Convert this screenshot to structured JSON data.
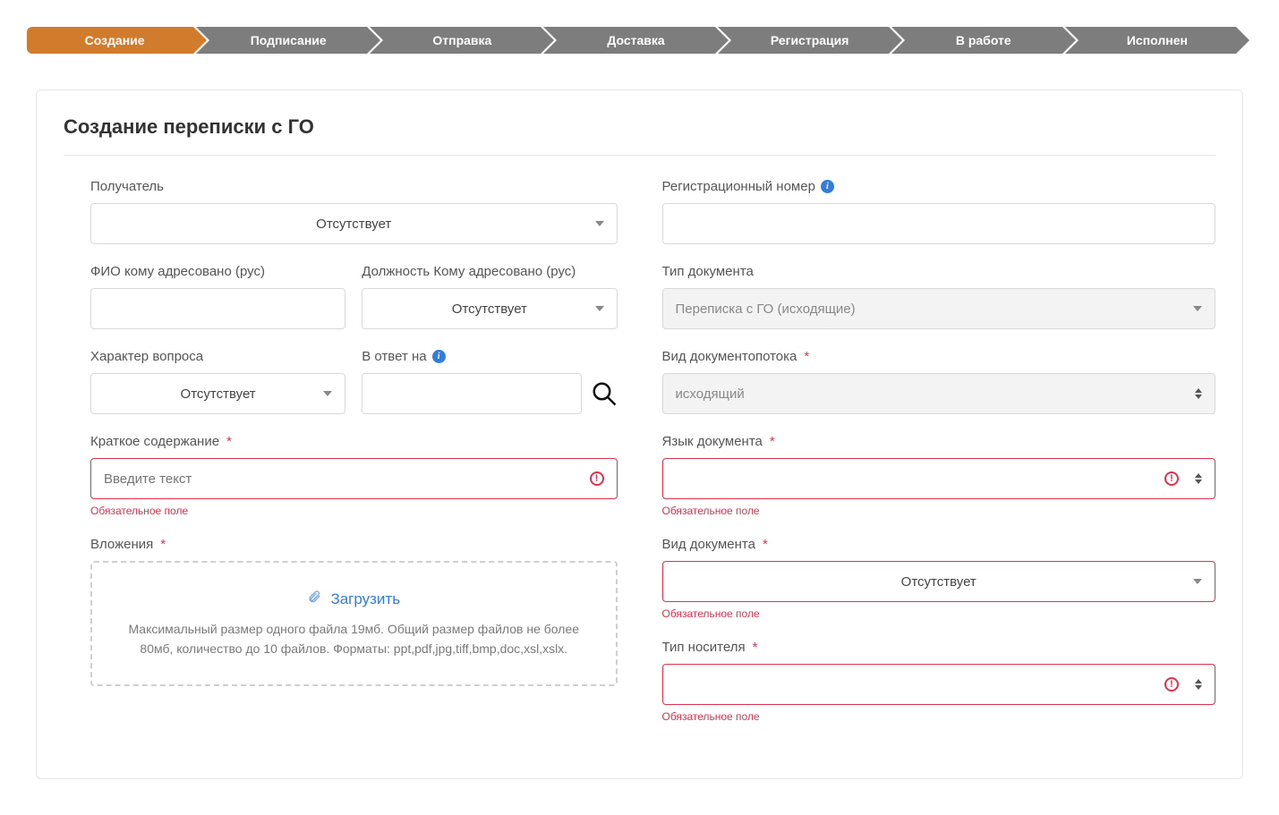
{
  "stepper": [
    {
      "label": "Создание",
      "active": true
    },
    {
      "label": "Подписание",
      "active": false
    },
    {
      "label": "Отправка",
      "active": false
    },
    {
      "label": "Доставка",
      "active": false
    },
    {
      "label": "Регистрация",
      "active": false
    },
    {
      "label": "В работе",
      "active": false
    },
    {
      "label": "Исполнен",
      "active": false
    }
  ],
  "page_title": "Создание переписки с ГО",
  "labels": {
    "recipient": "Получатель",
    "fio": "ФИО кому адресовано (рус)",
    "position": "Должность Кому адресовано (рус)",
    "question_type": "Характер вопроса",
    "reply_to": "В ответ на",
    "summary": "Краткое содержание",
    "attachments": "Вложения",
    "reg_number": "Регистрационный номер",
    "doc_type": "Тип документа",
    "flow_type": "Вид документопотока",
    "doc_lang": "Язык документа",
    "doc_kind": "Вид документа",
    "media_type": "Тип носителя"
  },
  "values": {
    "recipient": "Отсутствует",
    "position": "Отсутствует",
    "question_type": "Отсутствует",
    "doc_type": "Переписка с ГО (исходящие)",
    "flow_type": "исходящий",
    "doc_kind": "Отсутствует"
  },
  "placeholders": {
    "summary": "Введите текст"
  },
  "errors": {
    "required": "Обязательное поле"
  },
  "upload": {
    "link": "Загрузить",
    "hint": "Максимальный размер одного файла 19мб. Общий размер файлов не более 80мб, количество до 10 файлов. Форматы: ppt,pdf,jpg,tiff,bmp,doc,xsl,xslx."
  }
}
